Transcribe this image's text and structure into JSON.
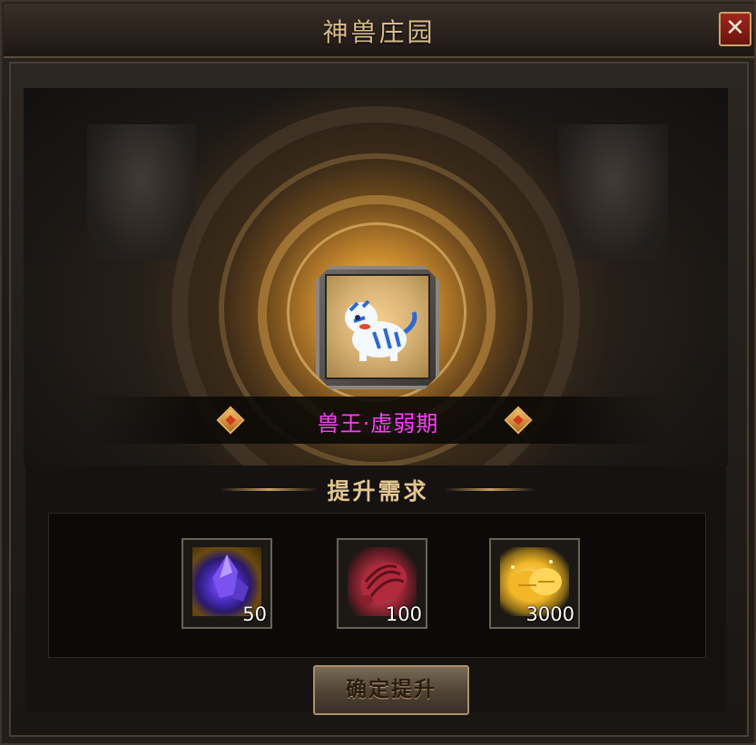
{
  "window": {
    "title": "神兽庄园",
    "close_label": "✕"
  },
  "pet": {
    "name": "兽王·虚弱期",
    "name_color": "#ff3cff",
    "icon": "white-tiger-icon"
  },
  "requirements": {
    "title": "提升需求",
    "items": [
      {
        "icon": "purple-crystal-icon",
        "qty": "50"
      },
      {
        "icon": "red-beetle-shell-icon",
        "qty": "100"
      },
      {
        "icon": "gold-coins-icon",
        "qty": "3000"
      }
    ]
  },
  "confirm_button": {
    "label": "确定提升"
  }
}
